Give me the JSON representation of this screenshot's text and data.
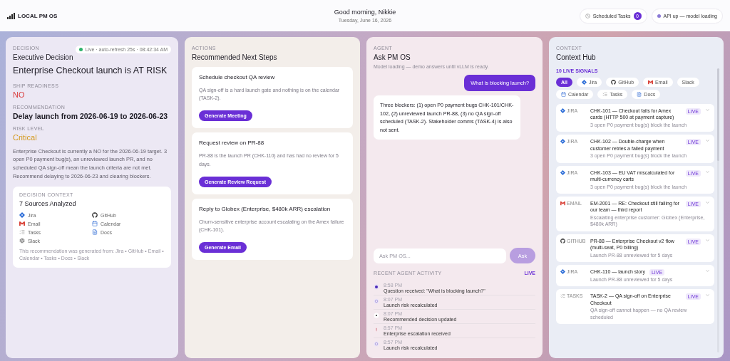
{
  "header": {
    "logo": "LOCAL PM OS",
    "greeting": "Good morning, Nikkie",
    "date": "Tuesday, June 16, 2026",
    "scheduled": {
      "label": "Scheduled Tasks",
      "count": "0"
    },
    "api_status": "API up — model loading"
  },
  "decision": {
    "section": "DECISION",
    "live_badge": "Live · auto-refresh 25s · 08:42:34 AM",
    "title": "Executive Decision",
    "headline": "Enterprise Checkout launch is AT RISK",
    "fields": [
      {
        "label": "SHIP READINESS",
        "value": "NO",
        "kind": "danger"
      },
      {
        "label": "RECOMMENDATION",
        "value": "Delay launch from 2026-06-19 to 2026-06-23",
        "kind": "plain"
      },
      {
        "label": "RISK LEVEL",
        "value": "Critical",
        "kind": "warning"
      }
    ],
    "summary": "Enterprise Checkout is currently a NO for the 2026-06-19 target. 3 open P0 payment bug(s), an unreviewed launch PR, and no scheduled QA sign-off mean the launch criteria are not met. Recommend delaying to 2026-06-23 and clearing blockers.",
    "context": {
      "section": "DECISION CONTEXT",
      "title": "7 Sources Analyzed",
      "sources": [
        {
          "name": "Jira",
          "kind": "jira"
        },
        {
          "name": "GitHub",
          "kind": "github"
        },
        {
          "name": "Email",
          "kind": "email"
        },
        {
          "name": "Calendar",
          "kind": "calendar"
        },
        {
          "name": "Tasks",
          "kind": "tasks"
        },
        {
          "name": "Docs",
          "kind": "docs"
        },
        {
          "name": "Slack",
          "kind": "slack"
        }
      ],
      "footnote": "This recommendation was generated from: Jira • GitHub • Email • Calendar • Tasks • Docs • Slack"
    }
  },
  "actions": {
    "section": "ACTIONS",
    "title": "Recommended Next Steps",
    "items": [
      {
        "title": "Schedule checkout QA review",
        "description": "QA sign-off is a hard launch gate and nothing is on the calendar (TASK-2).",
        "button": "Generate Meeting"
      },
      {
        "title": "Request review on PR-88",
        "description": "PR-88 is the launch PR (CHK-110) and has had no review for 5 days.",
        "button": "Generate Review Request"
      },
      {
        "title": "Reply to Globex (Enterprise, $480k ARR) escalation",
        "description": "Churn-sensitive enterprise account escalating on the Amex failure (CHK-101).",
        "button": "Generate Email"
      }
    ]
  },
  "agent": {
    "section": "AGENT",
    "title": "Ask PM OS",
    "status": "Model loading — demo answers until vLLM is ready.",
    "messages": [
      {
        "kind": "user",
        "text": "What is blocking launch?"
      },
      {
        "kind": "agent",
        "text": "Three blockers: (1) open P0 payment bugs CHK-101/CHK-102, (2) unreviewed launch PR-88, (3) no QA sign-off scheduled (TASK-2). Stakeholder comms (TASK-4) is also not sent."
      }
    ],
    "input": {
      "placeholder": "Ask PM OS..."
    },
    "ask_button": "Ask",
    "activity": {
      "title": "RECENT AGENT ACTIVITY",
      "live": "LIVE",
      "items": [
        {
          "time": "8:58 PM",
          "text": "Question received: \"What is blocking launch?\"",
          "kind": "question"
        },
        {
          "time": "8:07 PM",
          "text": "Launch risk recalculated",
          "kind": "risk"
        },
        {
          "time": "8:07 PM",
          "text": "Recommended decision updated",
          "kind": "decision"
        },
        {
          "time": "8:57 PM",
          "text": "Enterprise escalation received",
          "kind": "escalation"
        },
        {
          "time": "8:57 PM",
          "text": "Launch risk recalculated",
          "kind": "risk"
        }
      ]
    }
  },
  "context": {
    "section": "CONTEXT",
    "title": "Context Hub",
    "signal_count": "10 LIVE SIGNALS",
    "filters": [
      {
        "label": "All",
        "selected": true
      },
      {
        "label": "Jira",
        "kind": "jira",
        "selected": false
      },
      {
        "label": "GitHub",
        "kind": "github",
        "selected": false
      },
      {
        "label": "Email",
        "kind": "email",
        "selected": false
      },
      {
        "label": "Slack",
        "selected": false
      },
      {
        "label": "Calendar",
        "kind": "calendar",
        "selected": false
      },
      {
        "label": "Tasks",
        "kind": "tasks",
        "selected": false
      },
      {
        "label": "Docs",
        "kind": "docs",
        "selected": false
      }
    ],
    "signals": [
      {
        "kind": "jira",
        "source_label": "JIRA",
        "title": "CHK-101 — Checkout fails for Amex cards (HTTP 500 at payment capture)",
        "description": "3 open P0 payment bug(s) block the launch",
        "live": "LIVE"
      },
      {
        "kind": "jira",
        "source_label": "JIRA",
        "title": "CHK-102 — Double-charge when customer retries a failed payment",
        "description": "3 open P0 payment bug(s) block the launch",
        "live": "LIVE"
      },
      {
        "kind": "jira",
        "source_label": "JIRA",
        "title": "CHK-103 — EU VAT miscalculated for multi-currency carts",
        "description": "3 open P0 payment bug(s) block the launch",
        "live": "LIVE"
      },
      {
        "kind": "email",
        "source_label": "EMAIL",
        "title": "EM-2001 — RE: Checkout still failing for our team — third report",
        "description": "Escalating enterprise customer: Globex (Enterprise, $480k ARR)",
        "live": "LIVE"
      },
      {
        "kind": "github",
        "source_label": "GITHUB",
        "title": "PR-88 — Enterprise Checkout v2 flow (multi-seat, P0 billing)",
        "description": "Launch PR-88 unreviewed for 5 days",
        "live": "LIVE"
      },
      {
        "kind": "jira",
        "source_label": "JIRA",
        "title": "CHK-110 — launch story",
        "description": "Launch PR-88 unreviewed for 5 days",
        "live": "LIVE"
      },
      {
        "kind": "tasks",
        "source_label": "TASKS",
        "title": "TASK-2 — QA sign-off on Enterprise Checkout",
        "description": "QA sign-off cannot happen — no QA review scheduled",
        "live": "LIVE"
      }
    ]
  }
}
